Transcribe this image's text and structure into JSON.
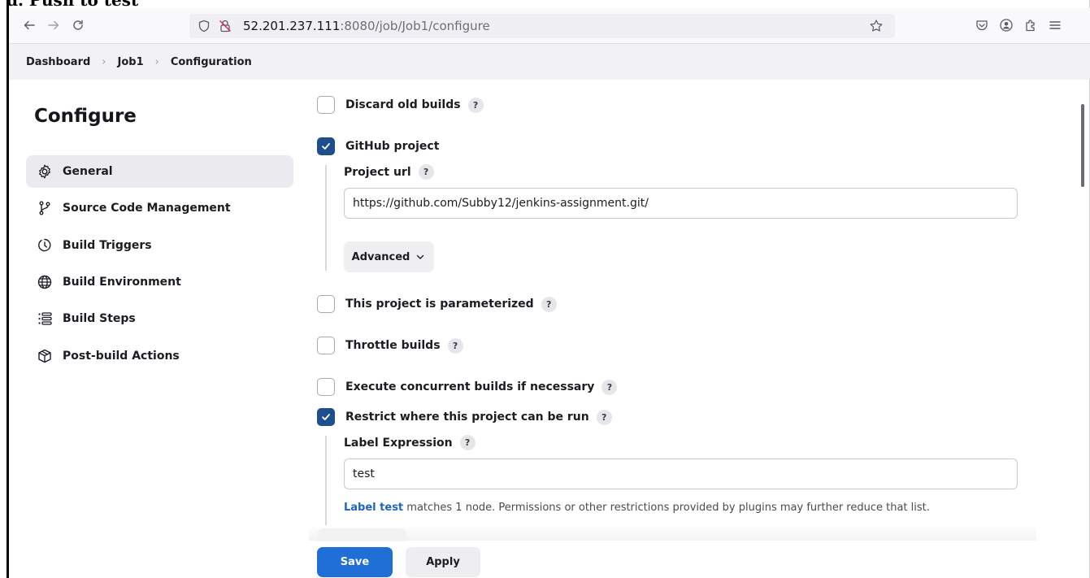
{
  "cutoff_caption": "d. Push to test",
  "browser": {
    "url_host": "52.201.237.111",
    "url_path": ":8080/job/Job1/configure",
    "icons": [
      "back-arrow-icon",
      "forward-arrow-icon",
      "reload-icon",
      "shield-icon",
      "insecure-lock-icon",
      "bookmark-star-icon",
      "pocket-icon",
      "account-icon",
      "extensions-icon",
      "menu-icon"
    ]
  },
  "breadcrumb": [
    "Dashboard",
    "Job1",
    "Configuration"
  ],
  "sidebar": {
    "title": "Configure",
    "items": [
      {
        "label": "General",
        "icon": "gear-icon",
        "active": true
      },
      {
        "label": "Source Code Management",
        "icon": "branch-icon"
      },
      {
        "label": "Build Triggers",
        "icon": "timer-icon"
      },
      {
        "label": "Build Environment",
        "icon": "globe-icon"
      },
      {
        "label": "Build Steps",
        "icon": "list-icon"
      },
      {
        "label": "Post-build Actions",
        "icon": "package-icon"
      }
    ]
  },
  "form": {
    "discard_old_builds": {
      "label": "Discard old builds",
      "checked": false
    },
    "github_project": {
      "label": "GitHub project",
      "checked": true
    },
    "project_url": {
      "label": "Project url",
      "value": "https://github.com/Subby12/jenkins-assignment.git/"
    },
    "advanced_label": "Advanced",
    "parameterized": {
      "label": "This project is parameterized",
      "checked": false
    },
    "throttle": {
      "label": "Throttle builds",
      "checked": false
    },
    "concurrent": {
      "label": "Execute concurrent builds if necessary",
      "checked": false
    },
    "restrict": {
      "label": "Restrict where this project can be run",
      "checked": true
    },
    "label_expression": {
      "label": "Label Expression",
      "value": "test"
    },
    "hint": {
      "link": "Label test",
      "text": " matches 1 node. Permissions or other restrictions provided by plugins may further reduce that list."
    },
    "help_glyph": "?"
  },
  "buttons": {
    "save": "Save",
    "apply": "Apply"
  },
  "colors": {
    "accent": "#1f6fd6",
    "checkbox_checked": "#1e4f8c",
    "link": "#1d63c8"
  }
}
